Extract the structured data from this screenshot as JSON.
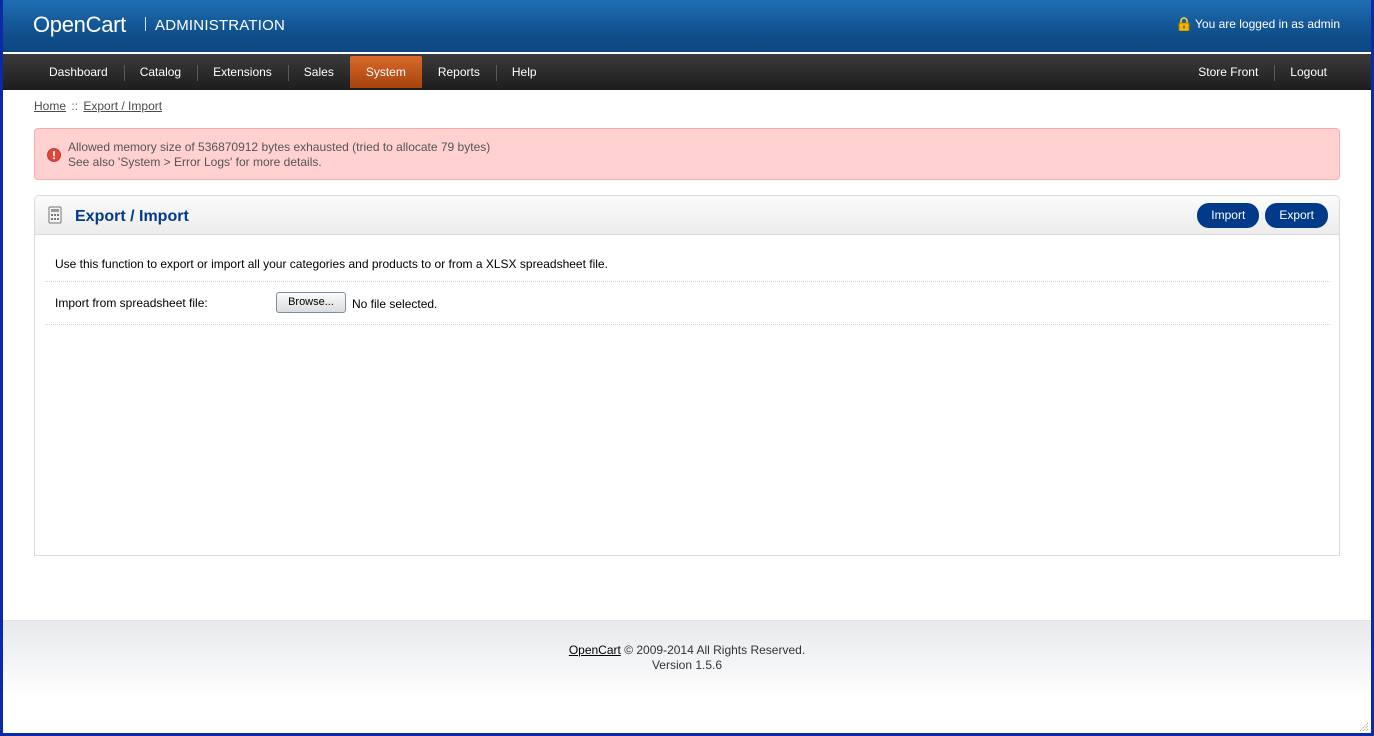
{
  "header": {
    "logo": "OpenCart",
    "subtitle": "ADMINISTRATION",
    "login_text": "You are logged in as admin",
    "lock_icon": "lock-icon"
  },
  "menu": {
    "left": [
      "Dashboard",
      "Catalog",
      "Extensions",
      "Sales",
      "System",
      "Reports",
      "Help"
    ],
    "active": "System",
    "right": [
      "Store Front",
      "Logout"
    ]
  },
  "breadcrumb": {
    "home": "Home",
    "separator": "::",
    "current": "Export / Import"
  },
  "warning": {
    "icon": "warning-icon",
    "line1": "Allowed memory size of 536870912 bytes exhausted (tried to allocate 79 bytes)",
    "line2": "See also 'System > Error Logs' for more details."
  },
  "box": {
    "title": "Export / Import",
    "icon": "module-icon",
    "import_button": "Import",
    "export_button": "Export",
    "description": "Use this function to export or import all your categories and products to or from a XLSX spreadsheet file.",
    "import_label": "Import from spreadsheet file:",
    "browse_button": "Browse...",
    "file_status": "No file selected."
  },
  "footer": {
    "link": "OpenCart",
    "copyright": "© 2009-2014 All Rights Reserved.",
    "version": "Version 1.5.6"
  },
  "colors": {
    "header_blue": "#0f4d8a",
    "menu_active": "#c0541c",
    "button_blue": "#003a88",
    "warning_bg": "#ffd1d1"
  }
}
